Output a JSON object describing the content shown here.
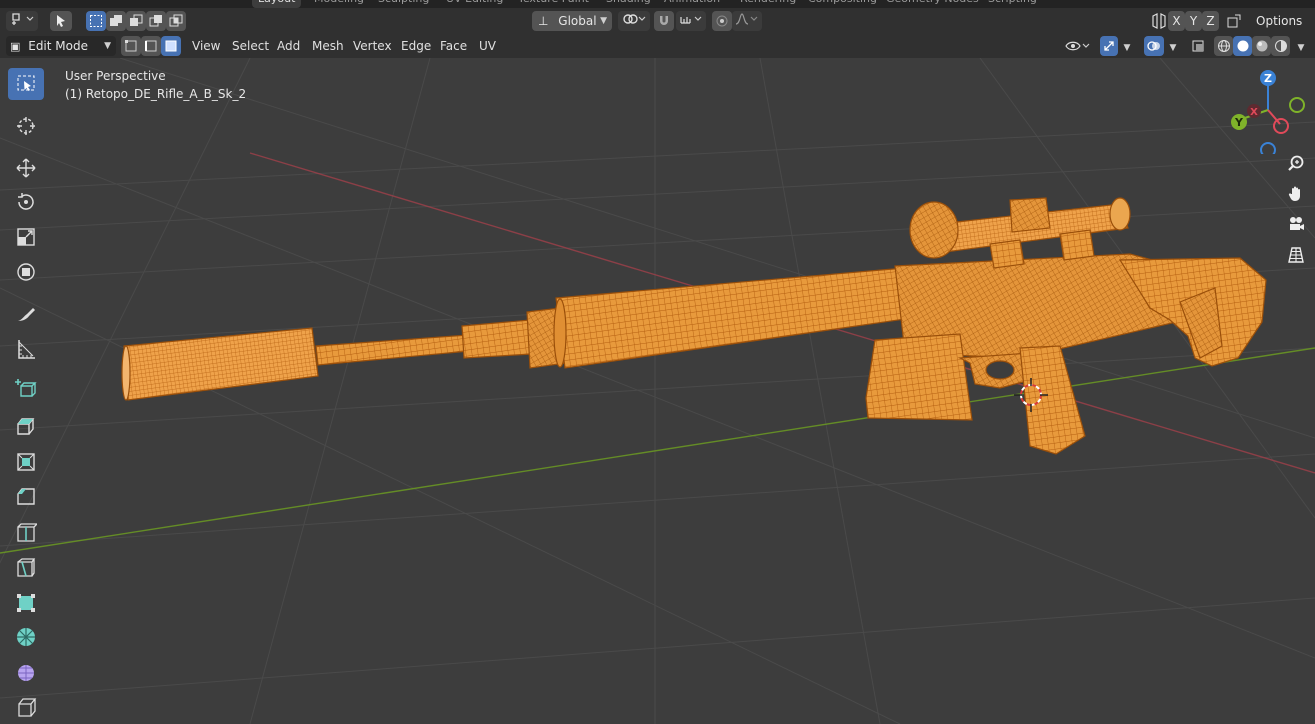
{
  "workspace_tabs": [
    {
      "label": "Layout",
      "active": true
    },
    {
      "label": "Modeling",
      "active": false
    },
    {
      "label": "Sculpting",
      "active": false
    },
    {
      "label": "UV Editing",
      "active": false
    },
    {
      "label": "Texture Paint",
      "active": false
    },
    {
      "label": "Shading",
      "active": false
    },
    {
      "label": "Animation",
      "active": false
    },
    {
      "label": "Rendering",
      "active": false
    },
    {
      "label": "Compositing",
      "active": false
    },
    {
      "label": "Geometry Nodes",
      "active": false
    },
    {
      "label": "Scripting",
      "active": false
    }
  ],
  "header": {
    "transform_orientation": "Global",
    "axis_x": "X",
    "axis_y": "Y",
    "axis_z": "Z",
    "options_label": "Options"
  },
  "edit_header": {
    "mode_label": "Edit Mode",
    "menus": [
      "View",
      "Select",
      "Add",
      "Mesh",
      "Vertex",
      "Edge",
      "Face",
      "UV"
    ]
  },
  "viewport": {
    "view_name": "User Perspective",
    "object_name": "(1) Retopo_DE_Rifle_A_B_Sk_2"
  },
  "gizmo": {
    "z_label": "Z",
    "y_label": "Y",
    "x_label": "X"
  },
  "colors": {
    "accent": "#4772b3",
    "mesh_orange": "#e89a3c",
    "mesh_wire": "#b55f10",
    "axis_x": "#e04a5a",
    "axis_y": "#7fb32a",
    "axis_z": "#3a82d6"
  },
  "icons": {
    "tools": [
      "select-box-icon",
      "cursor-icon",
      "move-icon",
      "rotate-icon",
      "scale-icon",
      "transform-icon",
      "annotate-icon",
      "measure-icon",
      "add-cube-icon",
      "extrude-icon",
      "inset-icon",
      "bevel-icon",
      "loop-cut-icon",
      "knife-icon",
      "poly-build-icon",
      "spin-icon",
      "smooth-icon",
      "shear-icon"
    ],
    "nav": [
      "zoom-icon",
      "pan-hand-icon",
      "camera-icon",
      "grid-view-icon"
    ]
  }
}
